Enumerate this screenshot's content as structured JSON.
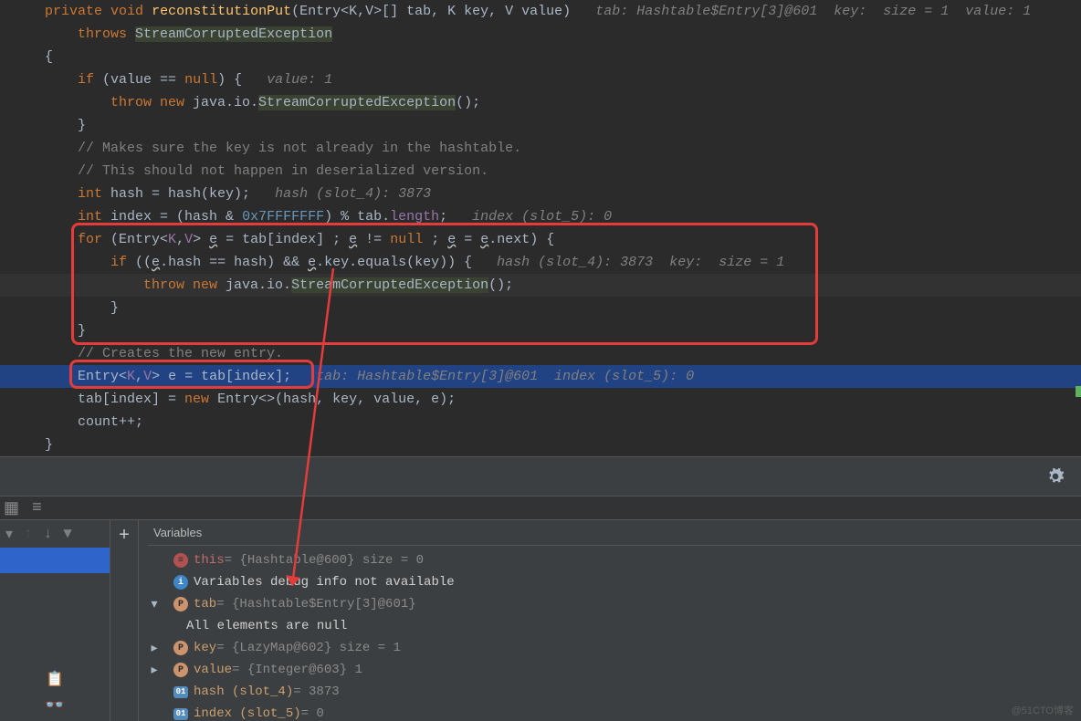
{
  "code": {
    "sig_private": "private",
    "sig_void": "void",
    "sig_fn": "reconstitutionPut",
    "sig_params": "(Entry<K,V>[] tab, K key, V value)",
    "sig_hint": "tab: Hashtable$Entry[3]@601  key:  size = 1  value: 1",
    "throws_kw": "throws",
    "throws_ty": "StreamCorruptedException",
    "brace_open": "{",
    "if1_a": "if",
    "if1_b": "(value == ",
    "if1_c": "null",
    "if1_d": ") {",
    "if1_hint": "value: 1",
    "throw1_a": "throw new",
    "throw1_b": " java.io.",
    "throw1_c": "StreamCorruptedException",
    "throw1_d": "();",
    "brace_c1": "}",
    "cm1": "// Makes sure the key is not already in the hashtable.",
    "cm2": "// This should not happen in deserialized version.",
    "hash_a": "int",
    "hash_b": " hash = hash(key);",
    "hash_hint": "hash (slot_4): 3873",
    "idx_a": "int",
    "idx_b": " index = (hash & ",
    "idx_c": "0x7FFFFFFF",
    "idx_d": ") % tab.",
    "idx_e": "length",
    "idx_f": ";",
    "idx_hint": "index (slot_5): 0",
    "for_a": "for",
    "for_b": " (Entry<",
    "for_c": "K",
    "for_d": ",",
    "for_e": "V",
    "for_f": "> ",
    "for_g": "e",
    "for_h": " = tab[index] ; ",
    "for_i": "e",
    "for_j": " != ",
    "for_k": "null",
    "for_l": " ; ",
    "for_m": "e",
    "for_n": " = ",
    "for_o": "e",
    "for_p": ".next) {",
    "if2_a": "if",
    "if2_b": " ((",
    "if2_c": "e",
    "if2_d": ".hash == hash) && ",
    "if2_e": "e",
    "if2_f": ".key.equals(key)) {",
    "if2_hint": "hash (slot_4): 3873  key:  size = 1",
    "throw2_a": "throw new",
    "throw2_b": " java.io.",
    "throw2_c": "StreamCorruptedException",
    "throw2_d": "();",
    "brace_c2": "}",
    "brace_c3": "}",
    "cm3": "// Creates the new entry.",
    "ent_a": "Entry<",
    "ent_b": "K",
    "ent_c": ",",
    "ent_d": "V",
    "ent_e": "> e = tab[index];",
    "ent_hint": "tab: Hashtable$Entry[3]@601  index (slot_5): 0",
    "assn_a": "tab[index] = ",
    "assn_b": "new",
    "assn_c": " Entry<>(hash, key, value, e);",
    "cnt": "count++;",
    "brace_close": "}"
  },
  "debug": {
    "varTitle": "Variables",
    "this_n": "this",
    "this_v": " = {Hashtable@600}  size = 0",
    "info": "Variables debug info not available",
    "tab_n": "tab",
    "tab_v": " = {Hashtable$Entry[3]@601}",
    "tab_sub": "All elements are null",
    "key_n": "key",
    "key_v": " = {LazyMap@602}  size = 1",
    "val_n": "value",
    "val_v": " = {Integer@603} 1",
    "hash_n": "hash (slot_4)",
    "hash_v": " = 3873",
    "idx_n": "index (slot_5)",
    "idx_v": " = 0"
  },
  "watermark": "@51CTO博客"
}
